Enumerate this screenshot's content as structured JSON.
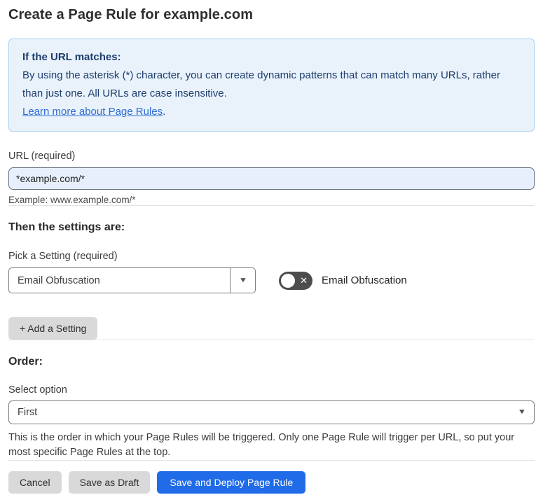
{
  "page": {
    "title": "Create a Page Rule for example.com"
  },
  "info_box": {
    "heading": "If the URL matches:",
    "body": "By using the asterisk (*) character, you can create dynamic patterns that can match many URLs, rather than just one. All URLs are case insensitive.",
    "link_label": "Learn more about Page Rules",
    "link_suffix": "."
  },
  "url_field": {
    "label": "URL (required)",
    "value": "*example.com/*",
    "helper": "Example: www.example.com/*"
  },
  "settings_section": {
    "heading": "Then the settings are:",
    "picker_label": "Pick a Setting (required)",
    "picker_value": "Email Obfuscation",
    "toggle_label": "Email Obfuscation",
    "toggle_state": "off",
    "add_setting_label": "+ Add a Setting"
  },
  "order_section": {
    "heading": "Order:",
    "select_label": "Select option",
    "select_value": "First",
    "helper": "This is the order in which your Page Rules will be triggered. Only one Page Rule will trigger per URL, so put your most specific Page Rules at the top."
  },
  "footer": {
    "cancel_label": "Cancel",
    "save_draft_label": "Save as Draft",
    "save_deploy_label": "Save and Deploy Page Rule"
  },
  "icons": {
    "chevron_down": "▼",
    "toggle_x": "✕"
  },
  "colors": {
    "accent_blue": "#1f6be8",
    "info_bg": "#e9f2fb",
    "info_border": "#abcfef",
    "info_text": "#1d3d6d",
    "link_blue": "#2c6cd4",
    "input_bg": "#e7effd",
    "toggle_off_bg": "#4d4d4d",
    "gray_button_bg": "#d9d9d9"
  }
}
